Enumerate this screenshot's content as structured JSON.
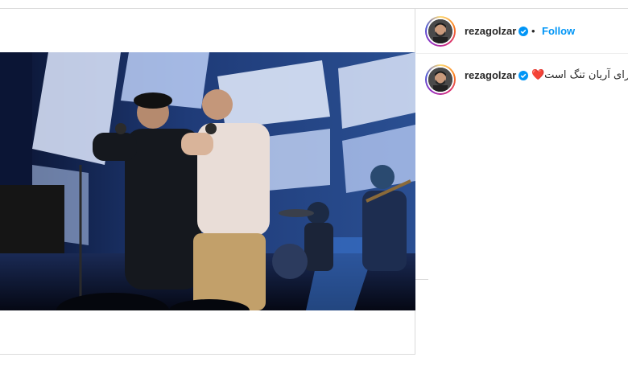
{
  "post": {
    "author": "rezagolzar",
    "verified": true,
    "separator": "•",
    "follow_label": "Follow",
    "caption": "دلم برای آریان تنگ است❤️",
    "media": {
      "type": "video",
      "muted": true
    }
  },
  "icons": {
    "verified": "verified-badge-icon",
    "mute": "speaker-muted-icon"
  },
  "colors": {
    "link": "#0095f6",
    "verified": "#0095f6",
    "border": "#dbdbdb",
    "text": "#262626"
  }
}
